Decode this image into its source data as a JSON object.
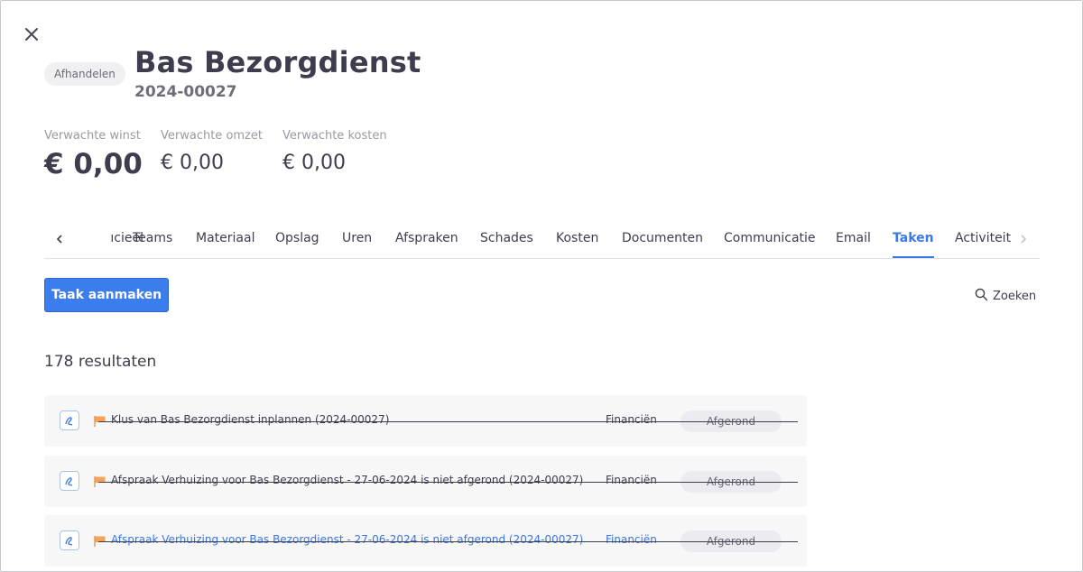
{
  "header": {
    "status": "Afhandelen",
    "title": "Bas Bezorgdienst",
    "number": "2024-00027"
  },
  "stats": [
    {
      "label": "Verwachte winst",
      "value": "€ 0,00"
    },
    {
      "label": "Verwachte omzet",
      "value": "€ 0,00"
    },
    {
      "label": "Verwachte kosten",
      "value": "€ 0,00"
    }
  ],
  "tabs": {
    "partial": "ıcieel",
    "items": [
      "Teams",
      "Materiaal",
      "Opslag",
      "Uren",
      "Afspraken",
      "Schades",
      "Kosten",
      "Documenten",
      "Communicatie",
      "Email",
      "Taken",
      "Activiteit"
    ],
    "active": "Taken"
  },
  "toolbar": {
    "create_label": "Taak aanmaken",
    "search_label": "Zoeken"
  },
  "results": {
    "count_text": "178 resultaten"
  },
  "tasks": [
    {
      "title": "Klus van Bas Bezorgdienst inplannen (2024-00027)",
      "category": "Financiën",
      "status": "Afgerond"
    },
    {
      "title": "Afspraak Verhuizing voor Bas Bezorgdienst - 27-06-2024 is niet afgerond (2024-00027)",
      "category": "Financiën",
      "status": "Afgerond"
    },
    {
      "title": "Afspraak Verhuizing voor Bas Bezorgdienst - 27-06-2024 is niet afgerond (2024-00027)",
      "category": "Financiën",
      "status": "Afgerond"
    }
  ],
  "colors": {
    "accent": "#3a78e6",
    "button": "#3b7ded",
    "flag": "#f5a35a"
  }
}
